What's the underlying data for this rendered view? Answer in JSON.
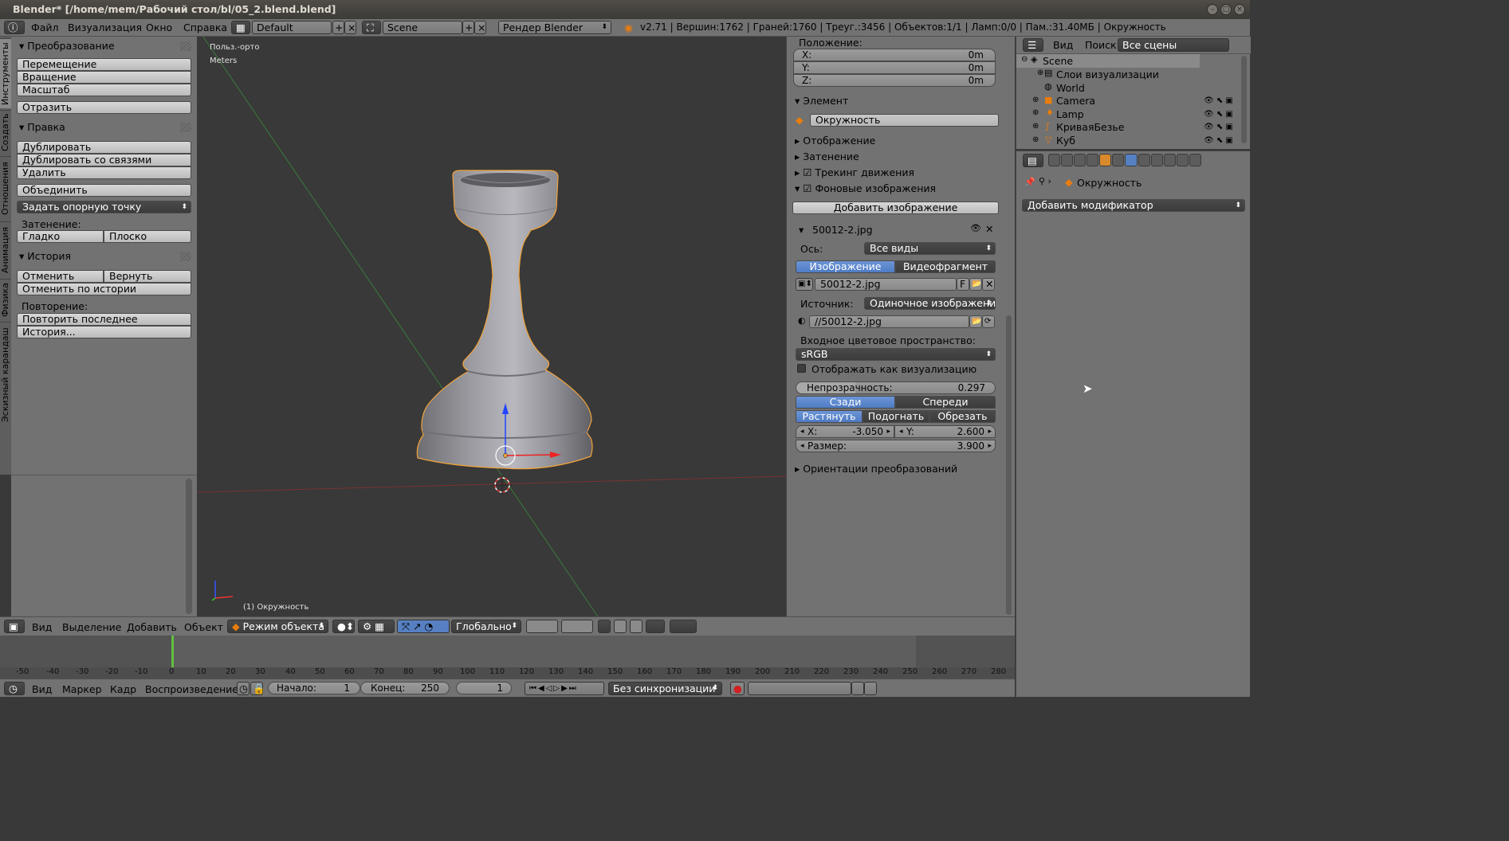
{
  "window": {
    "title": "Blender* [/home/mem/Рабочий стол/bl/05_2.blend.blend]"
  },
  "menubar": {
    "items": [
      "Файл",
      "Визуализация",
      "Окно",
      "Справка"
    ],
    "layout": "Default",
    "scene": "Scene",
    "engine": "Рендер Blender",
    "stats": "v2.71 | Вершин:1762 | Граней:1760 | Треуг.:3456 | Объектов:1/1 | Ламп:0/0 | Пам.:31.40МБ | Окружность"
  },
  "lefttabs": [
    "Инструменты",
    "Создать",
    "Отношения",
    "Анимация",
    "Физика",
    "Эскизный карандаш"
  ],
  "tools": {
    "transform_header": "Преобразование",
    "move": "Перемещение",
    "rotate": "Вращение",
    "scale": "Масштаб",
    "mirror": "Отразить",
    "edit_header": "Правка",
    "duplicate": "Дублировать",
    "duplicate_linked": "Дублировать со связями",
    "delete": "Удалить",
    "join": "Объединить",
    "set_origin": "Задать опорную точку",
    "shading_label": "Затенение:",
    "smooth": "Гладко",
    "flat": "Плоско",
    "history_header": "История",
    "undo": "Отменить",
    "redo": "Вернуть",
    "undo_history": "Отменить по истории",
    "repeat_label": "Повторение:",
    "repeat_last": "Повторить последнее",
    "history": "История..."
  },
  "viewport": {
    "view_name": "Польз.-орто",
    "units": "Meters",
    "object_label": "(1) Окружность"
  },
  "npanel": {
    "location_label": "Положение:",
    "x_label": "X:",
    "x_value": "0m",
    "y_label": "Y:",
    "y_value": "0m",
    "z_label": "Z:",
    "z_value": "0m",
    "item_header": "Элемент",
    "item_name": "Окружность",
    "display_header": "Отображение",
    "shading_header": "Затенение",
    "motion_tracking": "Трекинг движения",
    "bg_images": "Фоновые изображения",
    "add_image": "Добавить изображение",
    "image_name": "50012-2.jpg",
    "axis_label": "Ось:",
    "axis_value": "Все виды",
    "tab_image": "Изображение",
    "tab_clip": "Видеофрагмент",
    "image_field": "50012-2.jpg",
    "image_f": "F",
    "source_label": "Источник:",
    "source_value": "Одиночное изображение",
    "filepath": "//50012-2.jpg",
    "colorspace_label": "Входное цветовое пространство:",
    "colorspace_value": "sRGB",
    "show_as_render": "Отображать как визуализацию",
    "opacity_label": "Непрозрачность:",
    "opacity_value": "0.297",
    "back": "Сзади",
    "front": "Спереди",
    "stretch": "Растянуть",
    "fit": "Подогнать",
    "crop": "Обрезать",
    "ox_label": "X:",
    "ox_value": "-3.050",
    "oy_label": "Y:",
    "oy_value": "2.600",
    "size_label": "Размер:",
    "size_value": "3.900",
    "transform_orient": "Ориентации преобразований"
  },
  "outliner": {
    "view": "Вид",
    "search": "Поиск",
    "filter": "Все сцены",
    "items": [
      "Scene",
      "Слои визуализации",
      "World",
      "Camera",
      "Lamp",
      "КриваяБезье",
      "Куб"
    ]
  },
  "properties": {
    "object_name": "Окружность",
    "add_modifier": "Добавить модификатор"
  },
  "header3d": {
    "view": "Вид",
    "select": "Выделение",
    "add": "Добавить",
    "object": "Объект",
    "mode": "Режим объекта",
    "orientation": "Глобально"
  },
  "timeline": {
    "ticks": [
      "-50",
      "-40",
      "-30",
      "-20",
      "-10",
      "0",
      "10",
      "20",
      "30",
      "40",
      "50",
      "60",
      "70",
      "80",
      "90",
      "100",
      "110",
      "120",
      "130",
      "140",
      "150",
      "160",
      "170",
      "180",
      "190",
      "200",
      "210",
      "220",
      "230",
      "240",
      "250",
      "260",
      "270",
      "280"
    ],
    "view": "Вид",
    "marker": "Маркер",
    "frame": "Кадр",
    "playback": "Воспроизведение",
    "start_label": "Начало:",
    "start": "1",
    "end_label": "Конец:",
    "end": "250",
    "current": "1",
    "sync": "Без синхронизации"
  },
  "colors": {
    "bg": "#393939",
    "panel": "#727272",
    "selected": "#5680c2",
    "outline": "#f2a33a"
  }
}
